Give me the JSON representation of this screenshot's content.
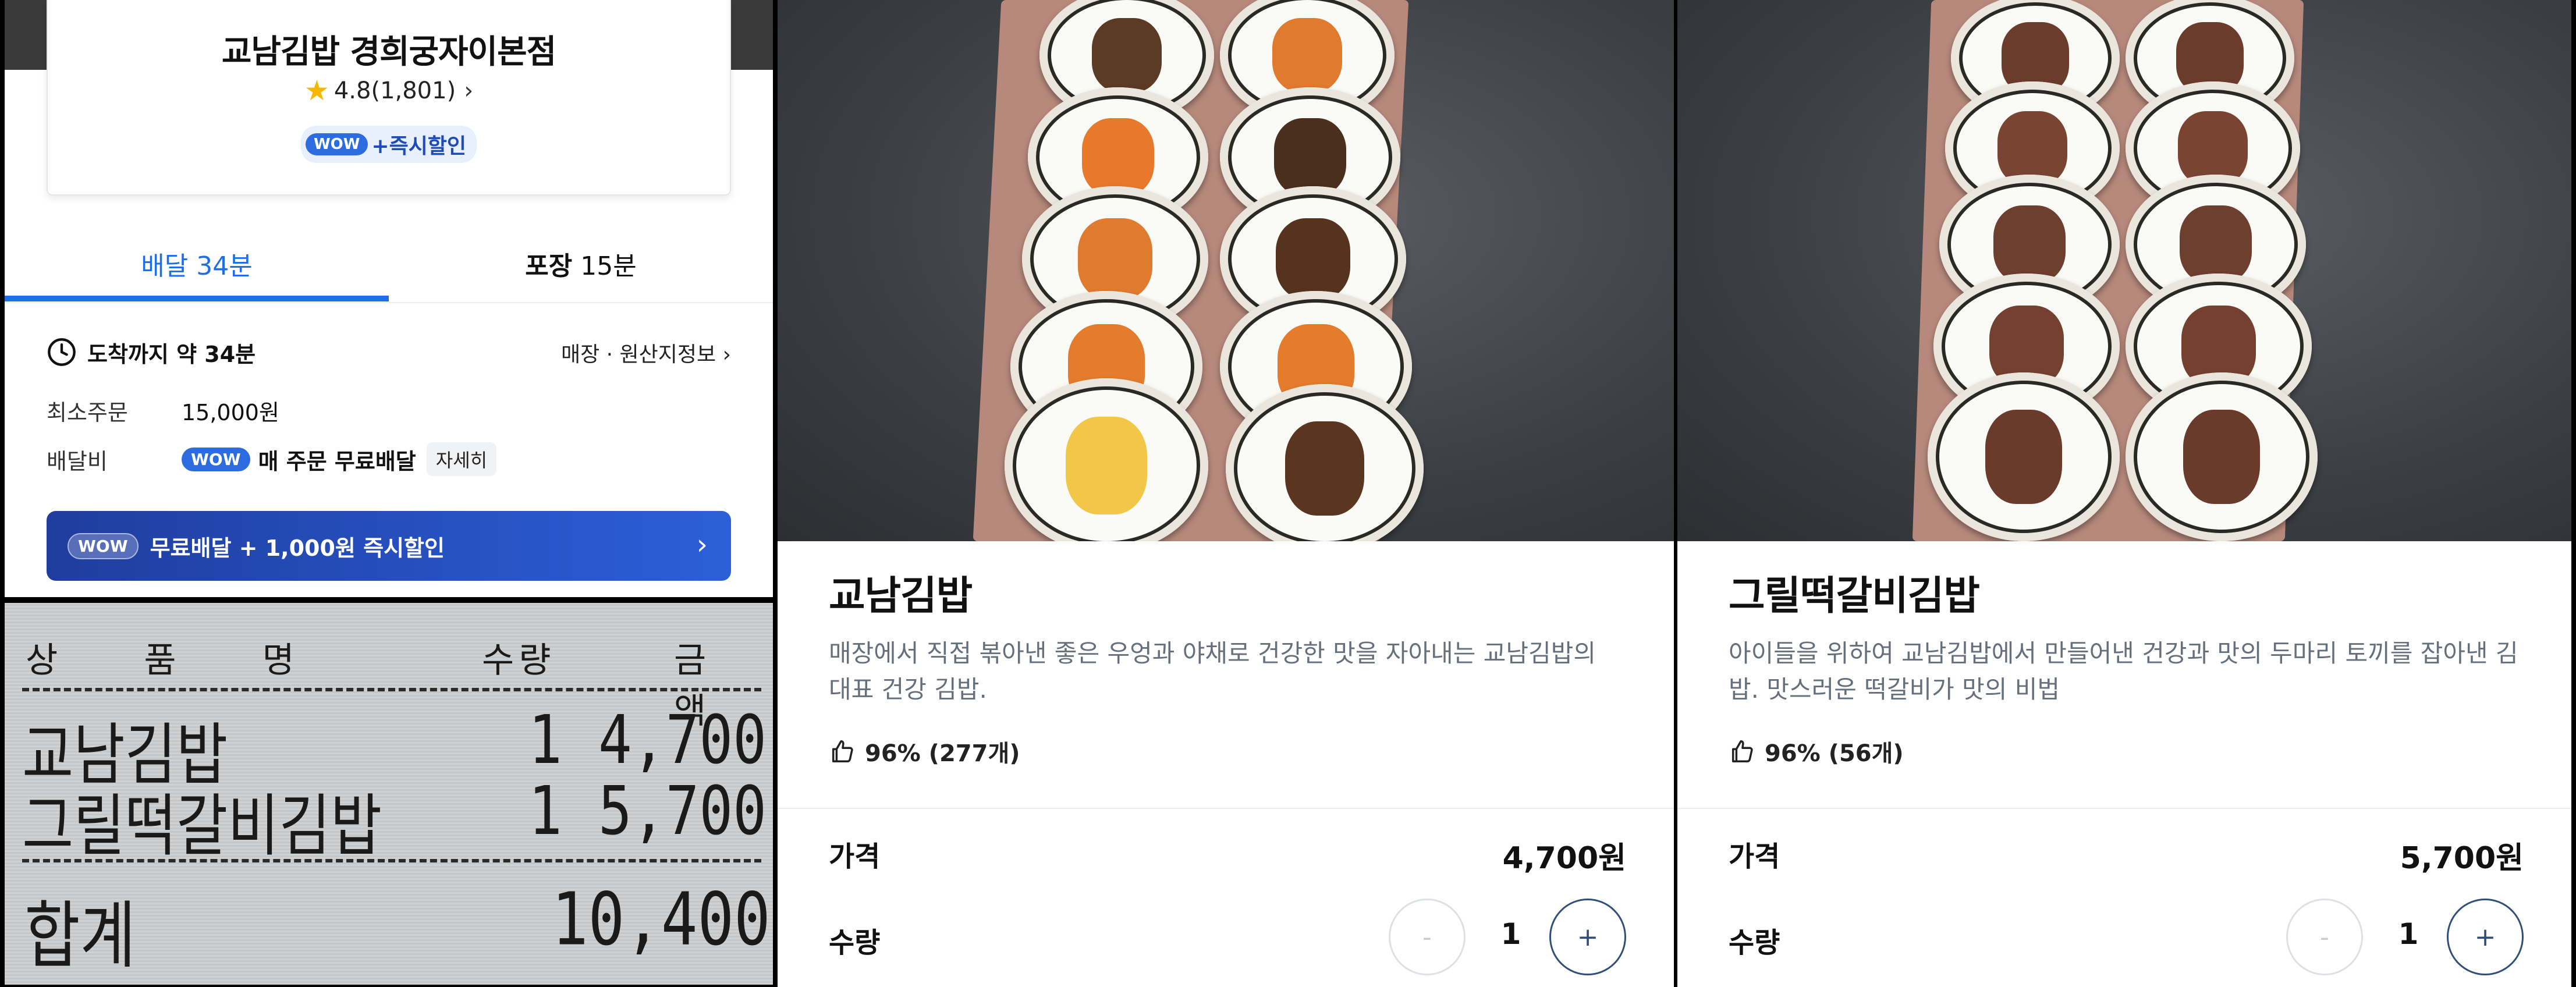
{
  "store": {
    "name": "교남김밥 경희궁자이본점",
    "rating": "4.8(1,801)",
    "wow_badge": "WOW",
    "wow_text": "+즉시할인",
    "tabs": [
      {
        "label": "배달 34분",
        "active": true
      },
      {
        "bold": "포장",
        "rest": " 15분",
        "active": false
      }
    ],
    "eta": "도착까지 약 34분",
    "origin_link": "매장 · 원산지정보",
    "min_order_label": "최소주문",
    "min_order_value": "15,000원",
    "delivery_fee_label": "배달비",
    "delivery_fee_badge": "WOW",
    "delivery_fee_text": "매 주문 무료배달",
    "delivery_fee_detail": "자세히",
    "banner_badge": "WOW",
    "banner_text": "무료배달 + 1,000원 즉시할인"
  },
  "receipt": {
    "headers": {
      "item": "상 품 명",
      "qty": "수량",
      "amount": "금액"
    },
    "items": [
      {
        "name": "교남김밥",
        "qty": "1",
        "amount": "4,700"
      },
      {
        "name": "그릴떡갈비김밥",
        "qty": "1",
        "amount": "5,700"
      }
    ],
    "total_label": "합계",
    "total_value": "10,400"
  },
  "products": [
    {
      "title": "교남김밥",
      "description": "매장에서 직접 볶아낸 좋은 우엉과 야채로 건강한 맛을 자아내는 교남김밥의 대표 건강 김밥.",
      "likes": "96% (277개)",
      "price_label": "가격",
      "price": "4,700원",
      "qty_label": "수량",
      "qty": "1",
      "minus": "-",
      "plus": "+"
    },
    {
      "title": "그릴떡갈비김밥",
      "description": "아이들을 위하여 교남김밥에서 만들어낸 건강과 맛의 두마리 토끼를 잡아낸 김밥. 맛스러운 떡갈비가 맛의 비법",
      "likes": "96% (56개)",
      "price_label": "가격",
      "price": "5,700원",
      "qty_label": "수량",
      "qty": "1",
      "minus": "-",
      "plus": "+"
    }
  ],
  "colors": {
    "accent": "#1e6ee8",
    "wow": "#2d6be0",
    "banner": "#1f3d9e"
  }
}
